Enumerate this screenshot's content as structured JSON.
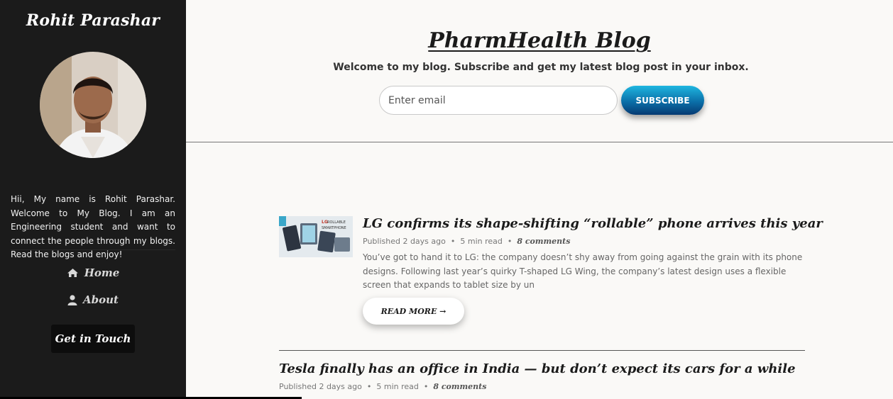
{
  "sidebar": {
    "name": "Rohit Parashar",
    "bio": "Hii, My name is Rohit Parashar. Welcome to My Blog. I am an Engineering student and want to connect the people through my blogs. Read the blogs and enjoy!",
    "nav": [
      {
        "label": "Home",
        "icon": "home-icon"
      },
      {
        "label": "About",
        "icon": "user-icon"
      }
    ],
    "cta_label": "Get in Touch"
  },
  "header": {
    "title": "PharmHealth Blog",
    "tagline": "Welcome to my blog. Subscribe and get my latest blog post in your inbox.",
    "email_placeholder": "Enter email",
    "subscribe_label": "SUBSCRIBE"
  },
  "posts": [
    {
      "title": "LG confirms its shape-shifting “rollable” phone arrives this year",
      "published": "Published 2 days ago",
      "read_time": "5 min read",
      "comments": "8 comments",
      "excerpt": "You’ve got to hand it to LG: the company doesn’t shy away from going against the grain with its phone designs. Following last year’s quirky T-shaped LG Wing, the company’s latest design uses a flexible screen that expands to tablet size by un",
      "read_more": "READ MORE →",
      "thumb_text": "LG ROLLABLE SMARTPHONE"
    },
    {
      "title": "Tesla finally has an office in India — but don’t expect its cars for a while",
      "published": "Published 2 days ago",
      "read_time": "5 min read",
      "comments": "8 comments"
    }
  ],
  "colors": {
    "sidebar_bg": "#1b1b1b",
    "page_bg": "#faf9f7",
    "subscribe_gradient_top": "#1fb6e0",
    "subscribe_gradient_bottom": "#063a72"
  }
}
